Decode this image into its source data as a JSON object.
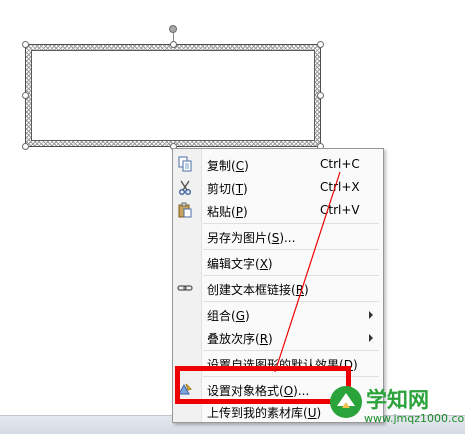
{
  "menu": {
    "items": [
      {
        "label_pre": "复制(",
        "mnemonic": "C",
        "label_post": ")",
        "shortcut": "Ctrl+C",
        "icon": "copy-icon"
      },
      {
        "label_pre": "剪切(",
        "mnemonic": "T",
        "label_post": ")",
        "shortcut": "Ctrl+X",
        "icon": "scissors-icon"
      },
      {
        "label_pre": "粘贴(",
        "mnemonic": "P",
        "label_post": ")",
        "shortcut": "Ctrl+V",
        "icon": "paste-icon"
      },
      {
        "label_pre": "另存为图片(",
        "mnemonic": "S",
        "label_post": ")..."
      },
      {
        "label_pre": "编辑文字(",
        "mnemonic": "X",
        "label_post": ")"
      },
      {
        "label_pre": "创建文本框链接(",
        "mnemonic": "R",
        "label_post": ")",
        "icon": "link-icon"
      },
      {
        "label_pre": "组合(",
        "mnemonic": "G",
        "label_post": ")",
        "submenu": true
      },
      {
        "label_pre": "叠放次序(",
        "mnemonic": "R",
        "label_post": ")",
        "submenu": true
      },
      {
        "label_pre": "设置自选图形的默认效果(",
        "mnemonic": "D",
        "label_post": ")"
      },
      {
        "label_pre": "设置对象格式(",
        "mnemonic": "O",
        "label_post": ")...",
        "icon": "format-object-icon"
      },
      {
        "label_pre": "上传到我的素材库(",
        "mnemonic": "U",
        "label_post": ")"
      }
    ]
  },
  "watermark": {
    "title": "学知网",
    "url": "www.jmqz1000.com"
  },
  "colors": {
    "highlight": "#ef0000",
    "watermark": "#2aa33a"
  }
}
